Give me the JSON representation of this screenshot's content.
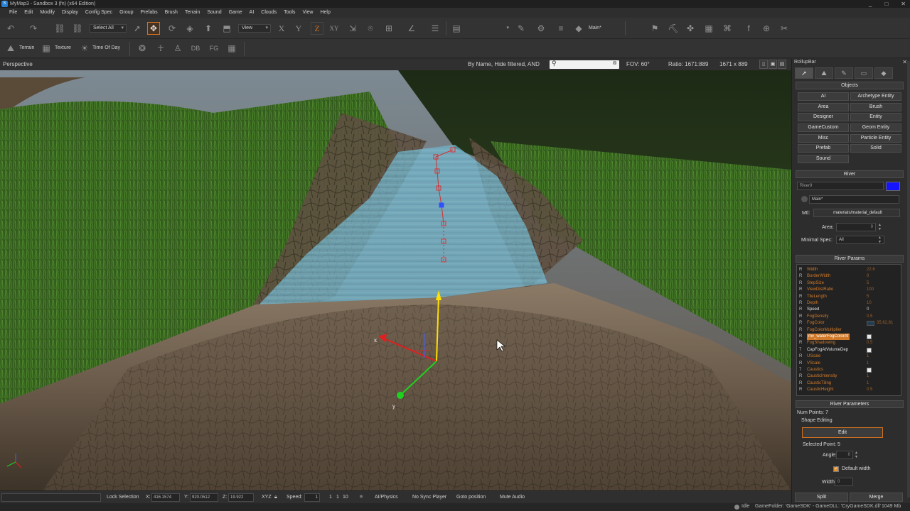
{
  "window": {
    "title": "MyMap3 - Sandbox 3 (fn) (x64 Edition)",
    "controls": [
      "_",
      "□",
      "✕"
    ]
  },
  "menu": [
    "File",
    "Edit",
    "Modify",
    "Display",
    "Config Spec",
    "Group",
    "Prefabs",
    "Brush",
    "Terrain",
    "Sound",
    "Game",
    "AI",
    "Clouds",
    "Tools",
    "View",
    "Help"
  ],
  "toolbar": {
    "select_filter": "Select All",
    "ref_coord": "View",
    "axis_x": "X",
    "axis_y": "Y",
    "axis_z": "Z",
    "axis_xy": "XY",
    "layer": "Main*",
    "terrain_label": "Terrain",
    "texture_label": "Texture",
    "time_of_day_label": "Time Of Day",
    "db_label": "DB",
    "fg_label": "FG"
  },
  "viewport": {
    "label": "Perspective",
    "filter_text": "By Name, Hide filtered, AND",
    "search_placeholder": "",
    "fov": "FOV:   60°",
    "ratio": "Ratio: 1671:889",
    "resolution": "1671 x 889",
    "gizmo_labels": {
      "x": "x",
      "y": "y"
    }
  },
  "rollup": {
    "title": "RollupBar",
    "objects_header": "Objects",
    "object_buttons": [
      "AI",
      "Archetype Entity",
      "Area",
      "Brush",
      "Designer",
      "Entity",
      "GameCustom",
      "Geom Entity",
      "Misc",
      "Particle Entity",
      "Prefab",
      "Solid",
      "Sound"
    ],
    "river_header": "River",
    "river_name": "River9",
    "river_color": "#1414ff",
    "layer_value": "Main*",
    "mtl_label": "Mtl:",
    "mtl_value": "materials/material_default",
    "area_label": "Area:",
    "area_value": "0",
    "minimal_spec_label": "Minimal Spec:",
    "minimal_spec_value": "All",
    "params_header": "River Params",
    "params": [
      {
        "icon": "R",
        "name": "Width",
        "value": "22.6"
      },
      {
        "icon": "R",
        "name": "BorderWidth",
        "value": "0"
      },
      {
        "icon": "R",
        "name": "StepSize",
        "value": "5"
      },
      {
        "icon": "R",
        "name": "ViewDistRatio",
        "value": "100"
      },
      {
        "icon": "R",
        "name": "TileLength",
        "value": "5"
      },
      {
        "icon": "R",
        "name": "Depth",
        "value": "10"
      },
      {
        "icon": "R",
        "name": "Speed",
        "value": "0",
        "white": true
      },
      {
        "icon": "R",
        "name": "FogDensity",
        "value": "0.5"
      },
      {
        "icon": "R",
        "name": "FogColor",
        "value": "35,62,81",
        "swatch": true
      },
      {
        "icon": "R",
        "name": "FogColorMultiplier",
        "value": ""
      },
      {
        "icon": "R",
        "name": "mv_waterFogColorAf",
        "value": "",
        "checkbox": true,
        "selected": true
      },
      {
        "icon": "R",
        "name": "FogShadowing",
        "value": "0.5"
      },
      {
        "icon": "7",
        "name": "CapFogAtVolumeDep",
        "value": "",
        "checkbox": true,
        "white": true
      },
      {
        "icon": "R",
        "name": "UScale",
        "value": "1"
      },
      {
        "icon": "R",
        "name": "VScale",
        "value": "1"
      },
      {
        "icon": "7",
        "name": "Caustics",
        "value": "",
        "checkbox": true
      },
      {
        "icon": "R",
        "name": "CausticIntensity",
        "value": "1"
      },
      {
        "icon": "R",
        "name": "CausticTiling",
        "value": "1"
      },
      {
        "icon": "R",
        "name": "CausticHeight",
        "value": "0.5"
      }
    ],
    "river_parameters_header": "River Parameters",
    "num_points": "Num Points: 7",
    "shape_editing": "Shape Editing",
    "edit_button": "Edit",
    "selected_point": "Selected Point: 5",
    "angle_label": "Angle:",
    "angle_value": "0",
    "default_width": "Default width",
    "width_label": "Width:",
    "width_value": "0",
    "split_button": "Split",
    "merge_button": "Merge"
  },
  "statusbar": {
    "lock_selection": "Lock Selection",
    "x_label": "X:",
    "x_value": "416.1574",
    "y_label": "Y:",
    "y_value": "920.0512",
    "z_label": "Z:",
    "z_value": "19.922",
    "xyz_label": "XYZ",
    "speed_label": "Speed:",
    "speed_value": "1",
    "speed_options": [
      "1",
      "1",
      "10"
    ],
    "ai_physics": "AI/Physics",
    "no_sync_player": "No Sync Player",
    "goto_position": "Goto position",
    "mute_audio": "Mute Audio",
    "idle": "Idle",
    "gamefolder": "GameFolder: 'GameSDK' - GameDLL: 'CryGameSDK.dll'",
    "memory": "1049 Mb"
  }
}
